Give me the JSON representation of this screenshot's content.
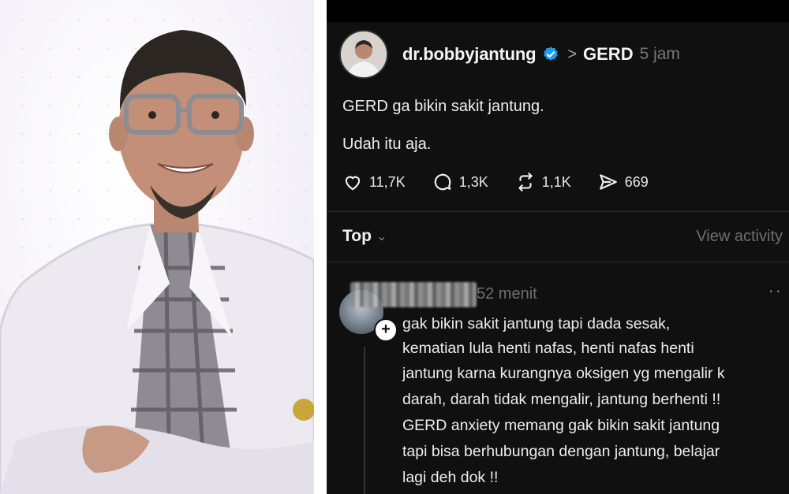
{
  "post": {
    "username": "dr.bobbyjantung",
    "verified": true,
    "chevron": ">",
    "topic": "GERD",
    "time": "5 jam",
    "lines": [
      "GERD ga bikin sakit jantung.",
      "Udah itu aja."
    ],
    "likes": "11,7K",
    "replies": "1,3K",
    "reposts": "1,1K",
    "shares": "669"
  },
  "sort": {
    "label": "Top",
    "view_activity": "View activity"
  },
  "comment": {
    "time": "52 menit",
    "more": "··",
    "lines": [
      "gak bikin sakit jantung tapi dada sesak,",
      "kematian lula henti nafas, henti nafas henti",
      "jantung karna kurangnya oksigen yg mengalir k",
      "darah, darah tidak mengalir, jantung berhenti !!",
      "GERD anxiety memang gak bikin sakit jantung",
      "tapi bisa berhubungan dengan jantung, belajar",
      "lagi deh dok !!"
    ]
  },
  "colors": {
    "accent": "#1d9bf0",
    "background": "#101010",
    "muted": "#777777"
  },
  "icons": [
    "heart-icon",
    "reply-icon",
    "repost-icon",
    "share-icon",
    "verified-badge-icon",
    "chevron-down-icon",
    "plus-icon",
    "more-icon"
  ]
}
